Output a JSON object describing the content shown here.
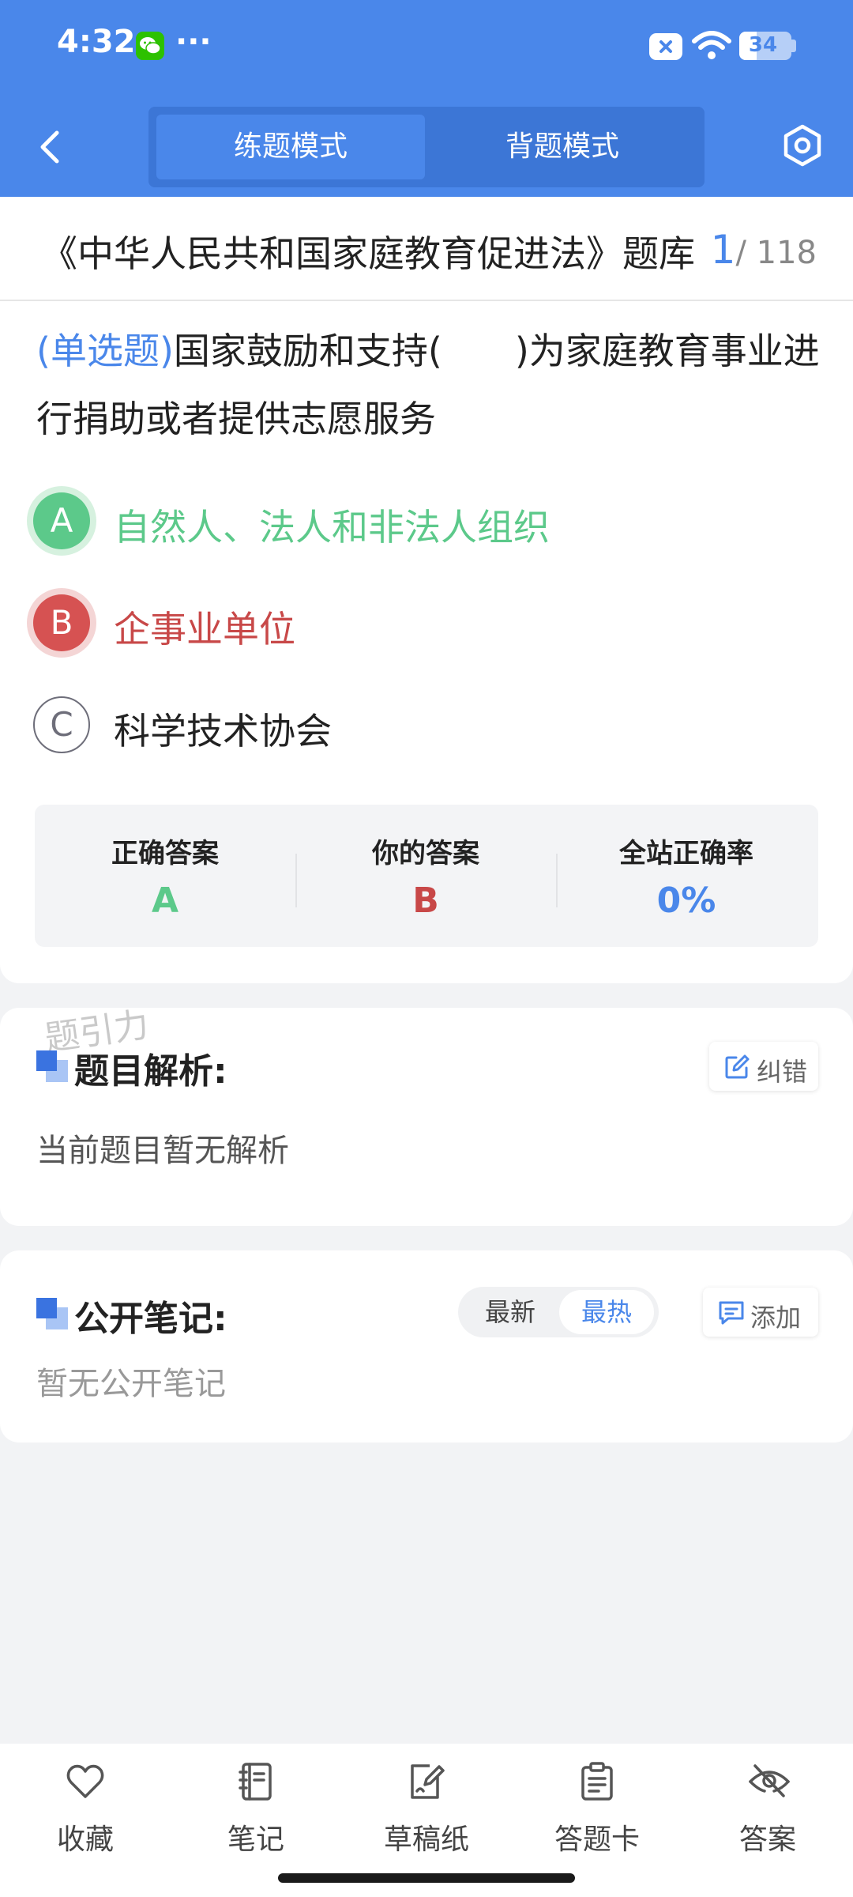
{
  "status_bar": {
    "time": "4:32",
    "dots": "···",
    "battery": "34"
  },
  "header": {
    "modes": [
      {
        "label": "练题模式",
        "active": true
      },
      {
        "label": "背题模式",
        "active": false
      }
    ]
  },
  "question_bank": {
    "title": "《中华人民共和国家庭教育促进法》题库",
    "current": "1",
    "total": "/ 118"
  },
  "question": {
    "type": "(单选题)",
    "text": "国家鼓励和支持(　　)为家庭教育事业进行捐助或者提供志愿服务",
    "options": [
      {
        "letter": "A",
        "text": "自然人、法人和非法人组织",
        "state": "correct"
      },
      {
        "letter": "B",
        "text": "企事业单位",
        "state": "wrong"
      },
      {
        "letter": "C",
        "text": "科学技术协会",
        "state": "normal"
      }
    ]
  },
  "answer_summary": {
    "correct_label": "正确答案",
    "correct_value": "A",
    "yours_label": "你的答案",
    "yours_value": "B",
    "rate_label": "全站正确率",
    "rate_value": "0%"
  },
  "analysis": {
    "watermark": "题引力",
    "title": "题目解析:",
    "report_button": "纠错",
    "content": "当前题目暂无解析"
  },
  "notes": {
    "title": "公开笔记:",
    "sort_options": [
      "最新",
      "最热"
    ],
    "sort_selected": "最热",
    "add_button": "添加",
    "empty_text": "暂无公开笔记"
  },
  "bottom_nav": [
    {
      "label": "收藏",
      "icon": "heart-icon"
    },
    {
      "label": "笔记",
      "icon": "notebook-icon"
    },
    {
      "label": "草稿纸",
      "icon": "draft-pad-icon"
    },
    {
      "label": "答题卡",
      "icon": "answer-sheet-icon"
    },
    {
      "label": "答案",
      "icon": "eye-off-icon"
    }
  ],
  "colors": {
    "primary": "#4a87ea",
    "correct": "#5cc98a",
    "wrong": "#d65252"
  }
}
